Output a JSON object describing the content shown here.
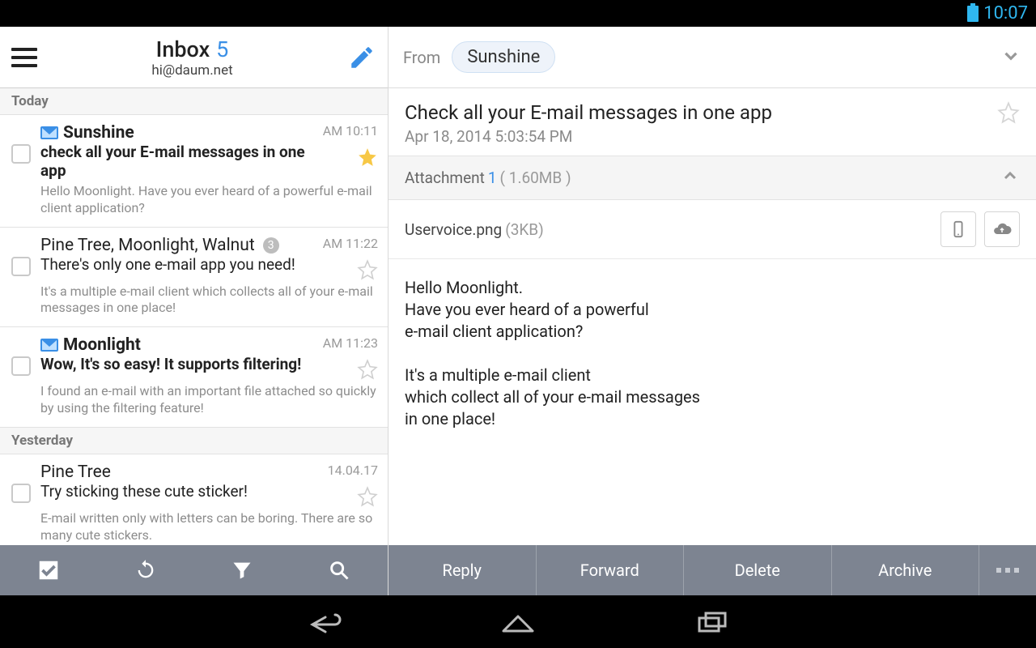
{
  "status": {
    "time": "10:07"
  },
  "left": {
    "title": "Inbox",
    "count": "5",
    "email": "hi@daum.net",
    "sections": [
      {
        "label": "Today"
      },
      {
        "label": "Yesterday"
      }
    ],
    "messages": [
      {
        "sender": "Sunshine",
        "unread": true,
        "time": "AM 10:11",
        "subject": "check all your E-mail messages in one app",
        "snippet": "Hello Moonlight. Have you ever heard of a powerful e-mail client application?",
        "starred": true,
        "badge": ""
      },
      {
        "sender": "Pine Tree, Moonlight, Walnut",
        "unread": false,
        "time": "AM 11:22",
        "subject": "There's only one e-mail app you need!",
        "snippet": "It's a multiple e-mail client which collects all of your e-mail messages in one place!",
        "starred": false,
        "badge": "3"
      },
      {
        "sender": "Moonlight",
        "unread": true,
        "time": "AM 11:23",
        "subject": "Wow, It's so easy! It supports filtering!",
        "snippet": "I found an e-mail with an important file attached so quickly by using the filtering feature!",
        "starred": false,
        "badge": ""
      },
      {
        "sender": "Pine Tree",
        "unread": false,
        "time": "14.04.17",
        "subject": "Try sticking these cute sticker!",
        "snippet": "E-mail written only with letters can be boring. There are so many cute stickers.",
        "starred": false,
        "badge": ""
      }
    ]
  },
  "right": {
    "from_label": "From",
    "from_name": "Sunshine",
    "subject": "Check all your E-mail messages in one app",
    "date": "Apr 18, 2014 5:03:54 PM",
    "attachment": {
      "label": "Attachment",
      "count": "1",
      "size": "( 1.60MB )"
    },
    "files": [
      {
        "name": "Uservoice.png",
        "size": "(3KB)"
      }
    ],
    "body": "Hello Moonlight.\nHave you ever heard of a powerful\ne-mail client application?\n\nIt's a multiple e-mail client\nwhich collect all of your e-mail messages\nin one place!"
  },
  "actions": {
    "reply": "Reply",
    "forward": "Forward",
    "delete": "Delete",
    "archive": "Archive"
  }
}
